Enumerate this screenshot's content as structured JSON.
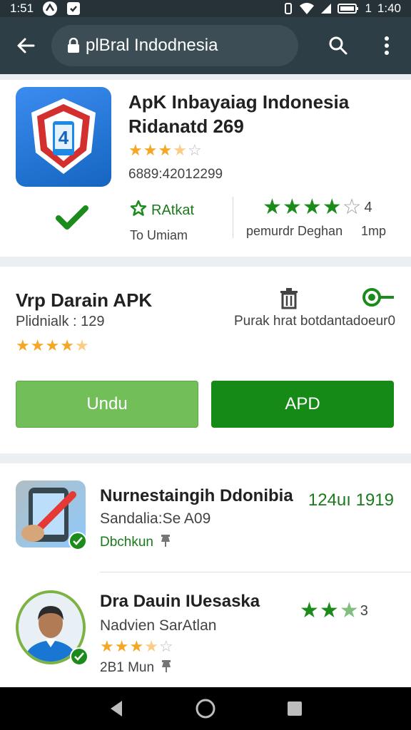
{
  "status_bar": {
    "time_left": "1:51",
    "time_right": "1:40",
    "battery_text": "1"
  },
  "browser": {
    "url": "plBral Indodnesia"
  },
  "app_card": {
    "title": "ApK Inbayaiag Indonesia",
    "subtitle": "Ridanatd 269",
    "rating_stars": 3.5,
    "code": "6889:42012299",
    "rate_label": "RAtkat",
    "rate_sub": "To Umiam",
    "green_rating_value": "4",
    "green_rating_stars": 4,
    "caption_left": "pemurdr Deghan",
    "caption_right": "1mp"
  },
  "download_card": {
    "title": "Vrp Darain APK",
    "count": "Plidnialk : 129",
    "rating_stars": 4.5,
    "description": "Purak hrat botdantadoeur0",
    "button_left": "Undu",
    "button_right": "APD"
  },
  "list": [
    {
      "title": "Nurnestaingih Ddonibia",
      "subtitle": "Sandalia:Se A09",
      "meta": "Dbchkun",
      "right": "124uı 1919"
    },
    {
      "title": "Dra Dauin IUesaska",
      "subtitle": "Nadvien SarAtlan",
      "rating_stars": 3.5,
      "meta": "2B1 Mun",
      "right_value": "3",
      "right_stars": 2.5
    }
  ],
  "colors": {
    "accent_green": "#1b8c1b",
    "appbar": "#2d3e46",
    "star": "#f5a623"
  }
}
